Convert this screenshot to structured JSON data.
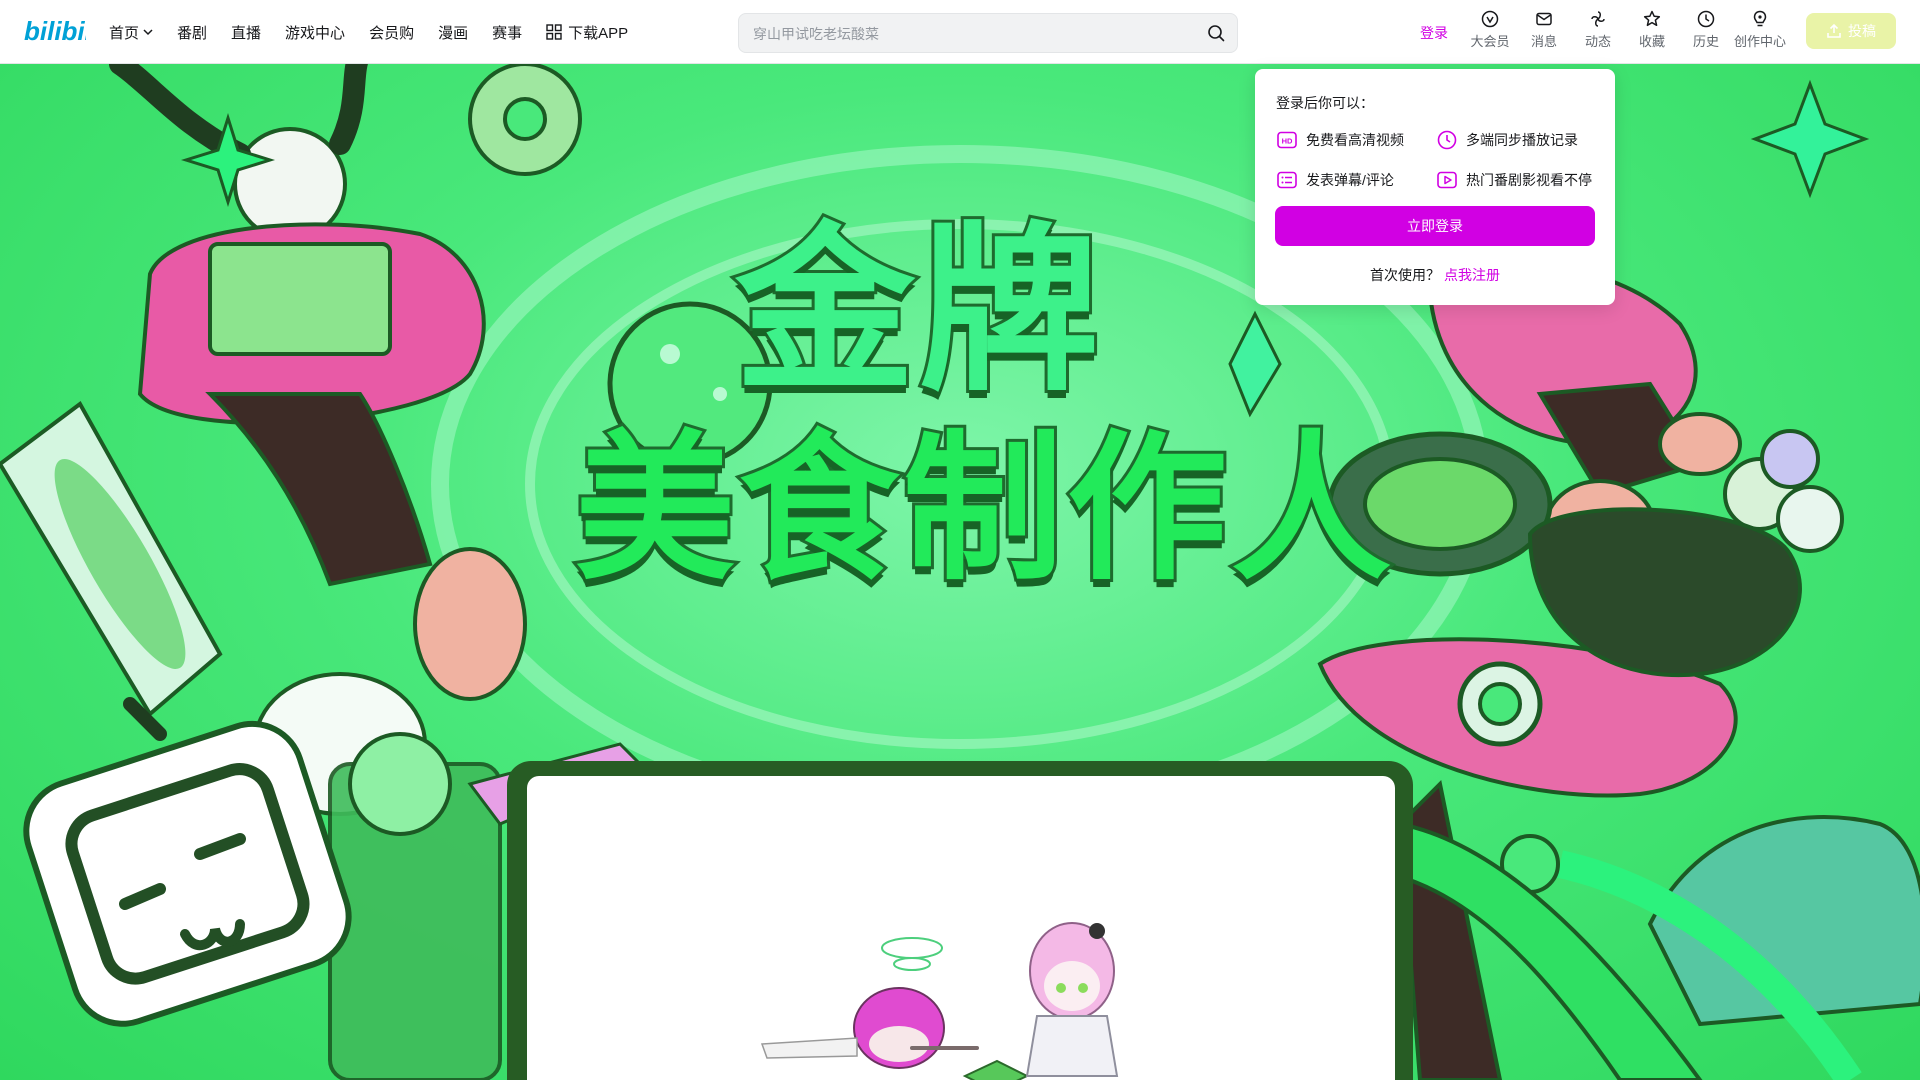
{
  "header": {
    "logo_text": "bilibili",
    "nav": [
      {
        "label": "首页",
        "icon": "chevron-down-icon"
      },
      {
        "label": "番剧"
      },
      {
        "label": "直播"
      },
      {
        "label": "游戏中心"
      },
      {
        "label": "会员购"
      },
      {
        "label": "漫画"
      },
      {
        "label": "赛事"
      },
      {
        "label": "下载APP",
        "icon": "app-grid-icon"
      }
    ],
    "search": {
      "placeholder": "穿山甲试吃老坛酸菜",
      "value": ""
    },
    "login_label": "登录",
    "right_icons": [
      {
        "label": "大会员",
        "icon": "vip-icon"
      },
      {
        "label": "消息",
        "icon": "mail-icon"
      },
      {
        "label": "动态",
        "icon": "wind-icon"
      },
      {
        "label": "收藏",
        "icon": "star-icon"
      },
      {
        "label": "历史",
        "icon": "clock-icon"
      },
      {
        "label": "创作中心",
        "icon": "bulb-icon"
      }
    ],
    "upload_label": "投稿",
    "accent_color": "#d100e3"
  },
  "banner": {
    "title_line1": "金牌",
    "title_line2": "美食制作人"
  },
  "login_popover": {
    "title": "登录后你可以：",
    "benefits": [
      {
        "label": "免费看高清视频",
        "icon": "hd-icon"
      },
      {
        "label": "多端同步播放记录",
        "icon": "clock-icon"
      },
      {
        "label": "发表弹幕/评论",
        "icon": "danmaku-list-icon"
      },
      {
        "label": "热门番剧影视看不停",
        "icon": "play-icon"
      }
    ],
    "login_button": "立即登录",
    "first_use_text": "首次使用？",
    "register_link": "点我注册"
  }
}
